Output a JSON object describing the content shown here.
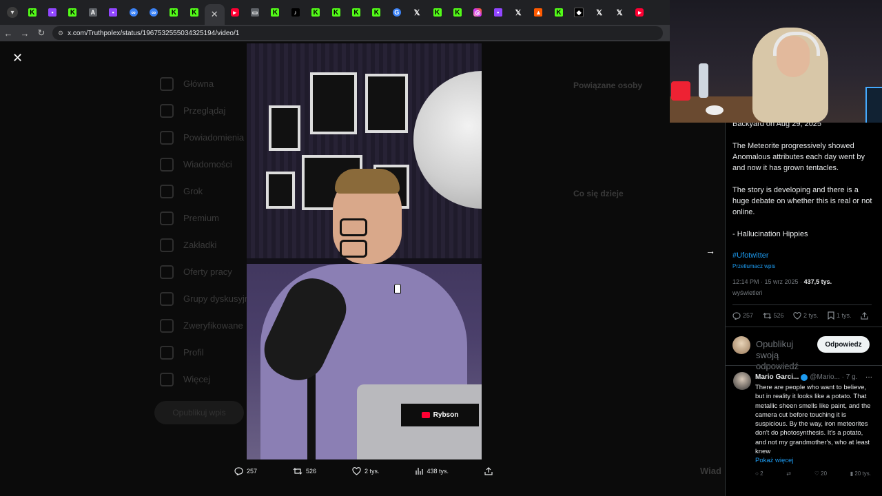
{
  "browser": {
    "menu_icon": "chevron-down-icon",
    "tabs": [
      {
        "icon": "kick-icon"
      },
      {
        "icon": "twitch-icon"
      },
      {
        "icon": "kick-icon"
      },
      {
        "icon": "translate-icon"
      },
      {
        "icon": "twitch-icon"
      },
      {
        "icon": "messenger-icon"
      },
      {
        "icon": "messenger-icon"
      },
      {
        "icon": "kick-icon"
      },
      {
        "icon": "kick-icon"
      },
      {
        "icon": "close-icon",
        "active": true
      },
      {
        "icon": "youtube-icon"
      },
      {
        "icon": "grey-icon"
      },
      {
        "icon": "kick-icon"
      },
      {
        "icon": "tiktok-icon"
      },
      {
        "icon": "kick-icon"
      },
      {
        "icon": "kick-icon"
      },
      {
        "icon": "kick-icon"
      },
      {
        "icon": "kick-icon"
      },
      {
        "icon": "gif-icon"
      },
      {
        "icon": "x-icon"
      },
      {
        "icon": "kick-icon"
      },
      {
        "icon": "kick-icon"
      },
      {
        "icon": "instagram-icon"
      },
      {
        "icon": "twitch-icon"
      },
      {
        "icon": "x-icon"
      },
      {
        "icon": "orange-icon"
      },
      {
        "icon": "kick-icon"
      },
      {
        "icon": "diamond-icon"
      },
      {
        "icon": "x-icon"
      },
      {
        "icon": "x-icon"
      },
      {
        "icon": "youtube-icon"
      }
    ],
    "url": "x.com/Truthpolex/status/1967532555034325194/video/1"
  },
  "video": {
    "channel_badge": "Rybson",
    "close_glyph": "✕",
    "actions": {
      "replies": "257",
      "reposts": "526",
      "likes": "2 tys.",
      "views": "438 tys."
    }
  },
  "tweet": {
    "cut_line": "Backyard on Aug 29, 2025",
    "paragraphs": [
      "The Meteorite progressively showed Anomalous attributes each day went by and now it has grown tentacles.",
      "The story is developing and there is a huge debate on whether this is real or not online.",
      "- Hallucination Hippies"
    ],
    "hashtag": "#Ufotwitter",
    "translate": "Przetłumacz wpis",
    "time": "12:14 PM · 15 wrz 2025 · ",
    "views_count": "437,5 tys.",
    "views_label": "wyświetleń",
    "stats": {
      "replies": "257",
      "reposts": "526",
      "likes": "2 tys.",
      "bookmarks": "1 tys."
    },
    "reply_placeholder": "Opublikuj swoją odpowiedź",
    "reply_button": "Odpowiedz"
  },
  "comment": {
    "name": "Mario Garci...",
    "handle": "@Mario...",
    "time": "· 7 g.",
    "more": "···",
    "text": "There are people who want to believe, but in reality it looks like a potato. That metallic sheen smells like paint, and the camera cut before touching it is suspicious. By the way, iron meteorites don't do photosynthesis. It's a potato, and not my grandmother's, who at least knew",
    "show_more": "Pokaż więcej",
    "stats": {
      "replies": "2",
      "reposts": "",
      "likes": "20",
      "views": "20 tys."
    }
  },
  "background": {
    "nav": [
      "Główna",
      "Przeglądaj",
      "Powiadomienia",
      "Wiadomości",
      "Grok",
      "Premium",
      "Zakładki",
      "Oferty pracy",
      "Grupy dyskusyjne",
      "Zweryfikowane",
      "Profil",
      "Więcej"
    ],
    "post_button": "Opublikuj wpis",
    "sidebar_heading_1": "Powiązane osoby",
    "sidebar_heading_2": "Co się dzieje",
    "bottom_right_partial": "Wiad"
  }
}
